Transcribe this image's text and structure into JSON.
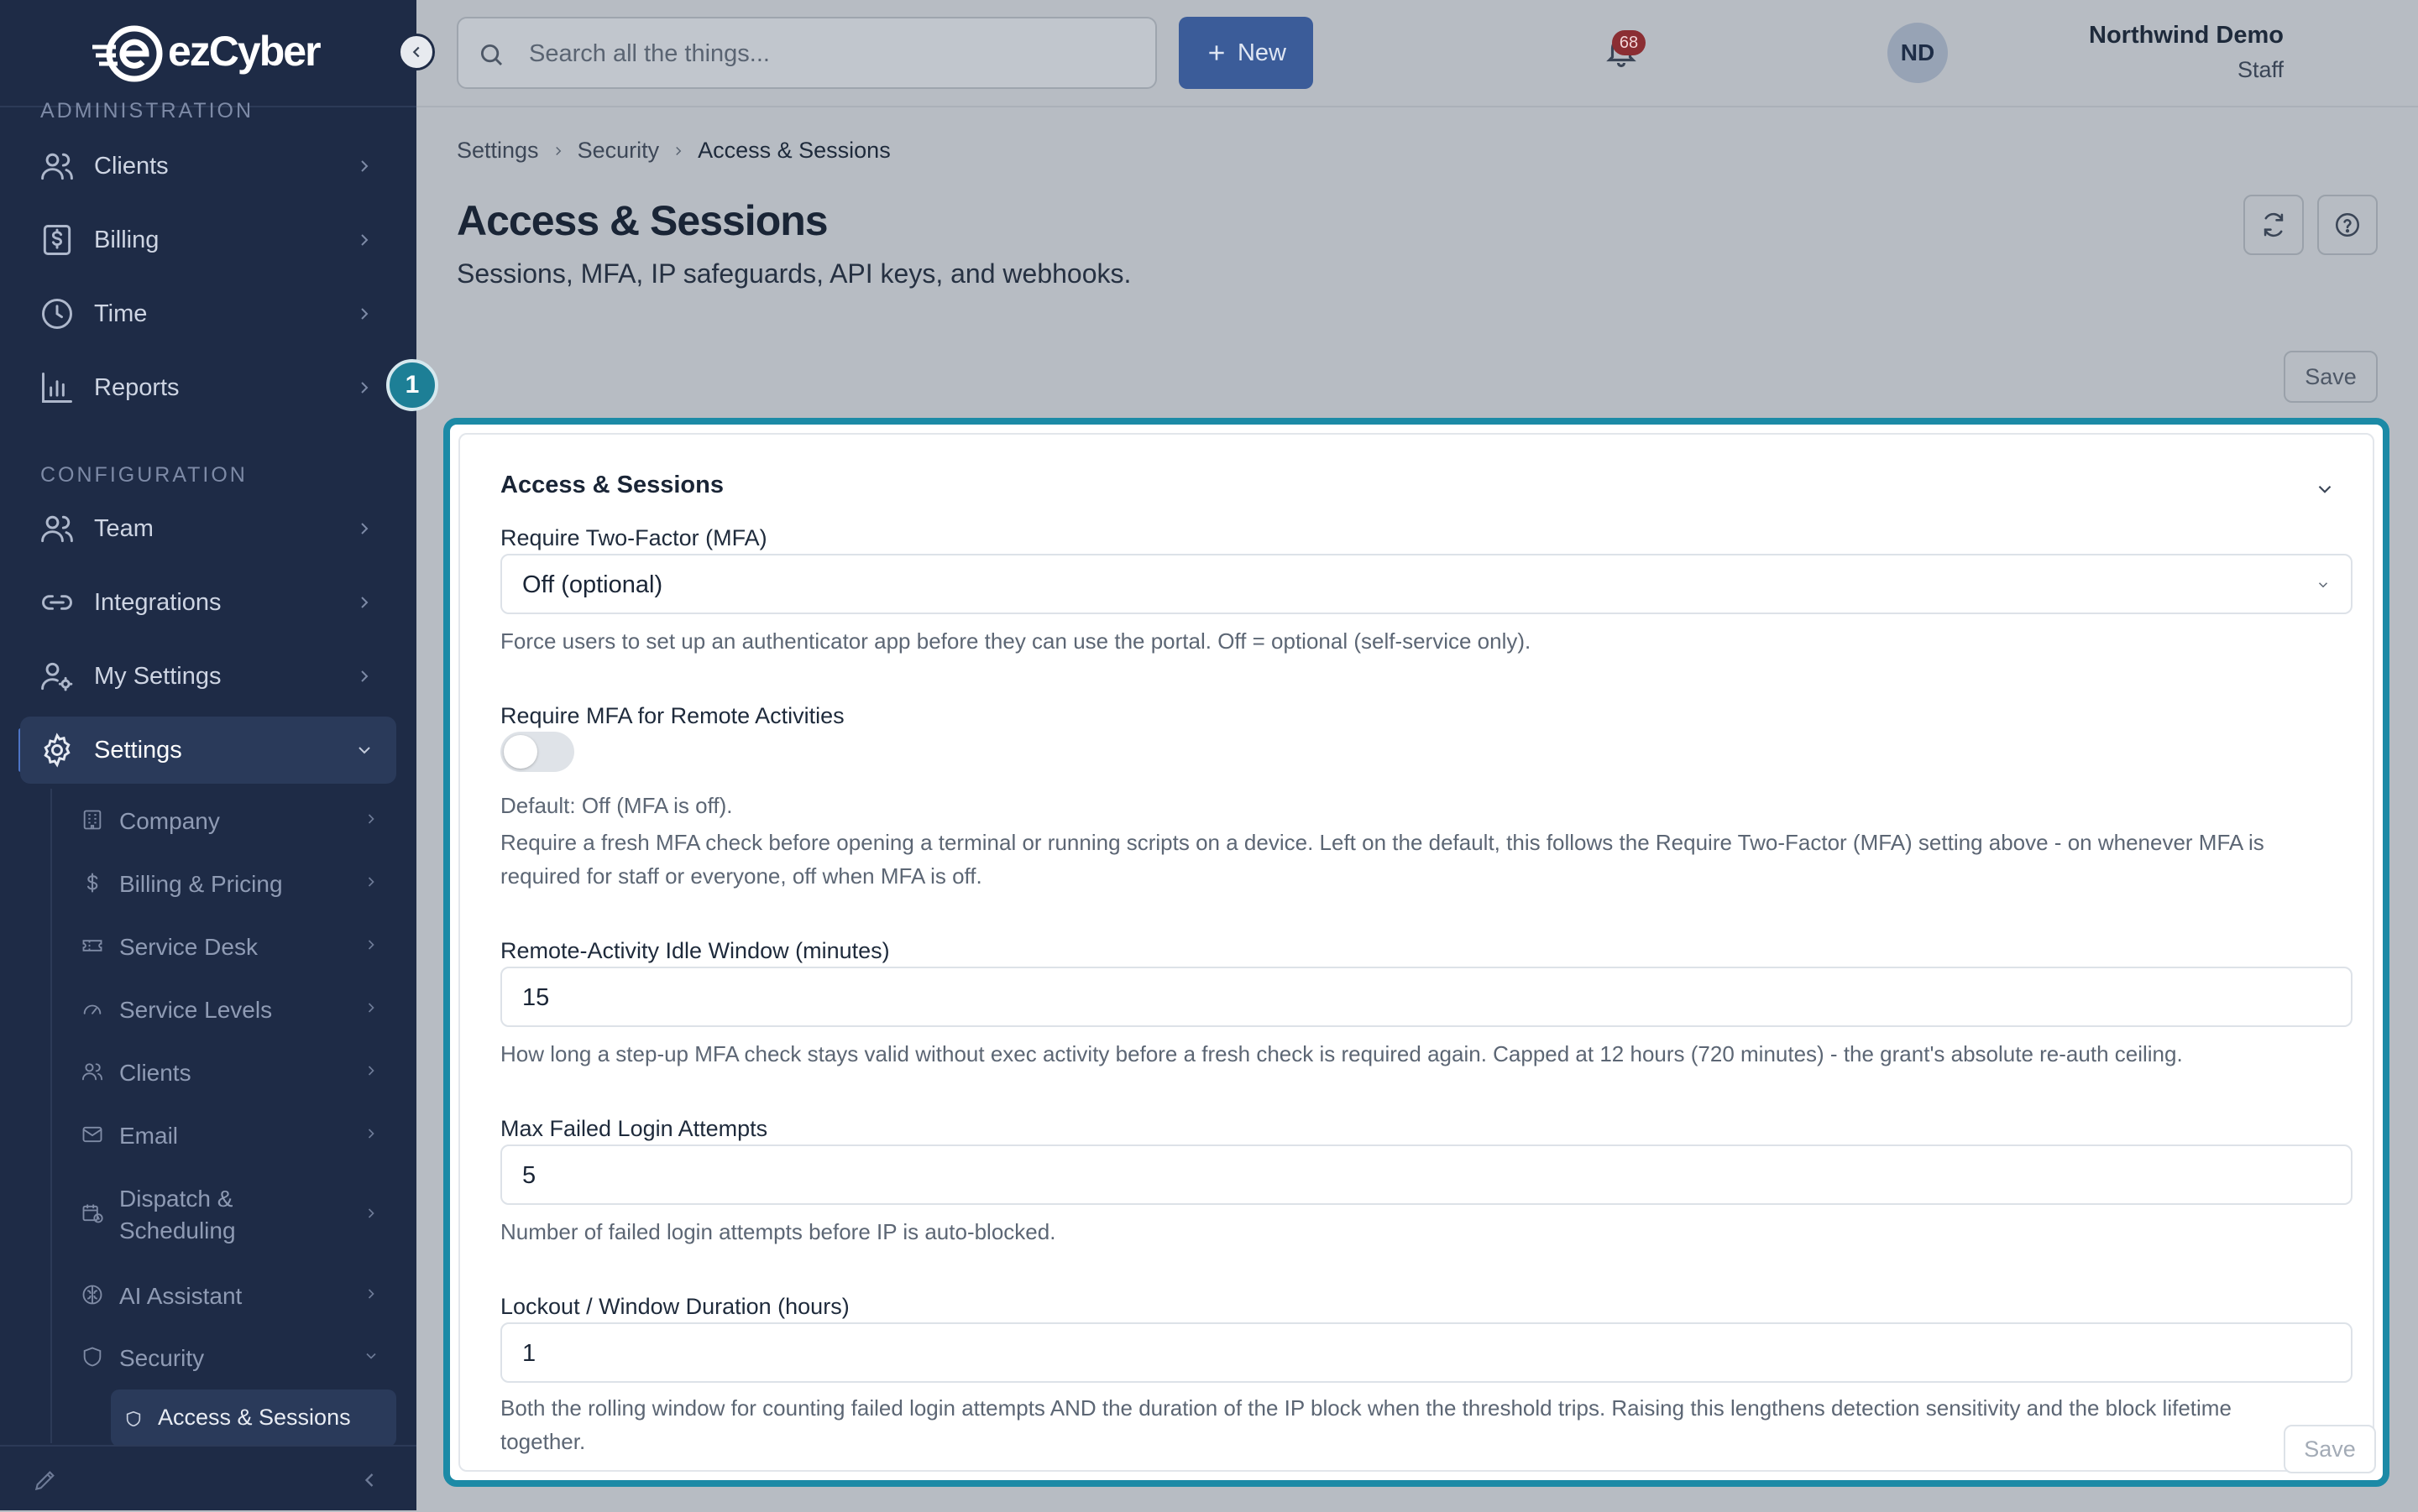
{
  "brand": {
    "logo_text": "ezCyber"
  },
  "sidebar": {
    "administration_label": "ADMINISTRATION",
    "configuration_label": "CONFIGURATION",
    "admin_items": [
      {
        "label": "Clients",
        "icon": "users-icon"
      },
      {
        "label": "Billing",
        "icon": "dollar-receipt-icon"
      },
      {
        "label": "Time",
        "icon": "clock-icon"
      },
      {
        "label": "Reports",
        "icon": "bar-chart-icon"
      }
    ],
    "config_items": [
      {
        "label": "Team",
        "icon": "users-icon"
      },
      {
        "label": "Integrations",
        "icon": "link-icon"
      },
      {
        "label": "My Settings",
        "icon": "user-gear-icon"
      },
      {
        "label": "Settings",
        "icon": "gear-icon",
        "active": true
      }
    ],
    "settings_sub_items": [
      {
        "label": "Company",
        "icon": "building-icon"
      },
      {
        "label": "Billing & Pricing",
        "icon": "dollar-icon"
      },
      {
        "label": "Service Desk",
        "icon": "ticket-icon"
      },
      {
        "label": "Service Levels",
        "icon": "gauge-icon"
      },
      {
        "label": "Clients",
        "icon": "users-icon"
      },
      {
        "label": "Email",
        "icon": "mail-icon"
      },
      {
        "label": "Dispatch &\nScheduling",
        "icon": "calendar-clock-icon"
      },
      {
        "label": "AI Assistant",
        "icon": "brain-icon"
      },
      {
        "label": "Security",
        "icon": "shield-icon",
        "expanded": true
      }
    ],
    "security_sub_items": [
      {
        "label": "Access & Sessions",
        "icon": "shield-icon",
        "active": true
      }
    ]
  },
  "header": {
    "search_placeholder": "Search all the things...",
    "new_button": "New",
    "notification_count": "68",
    "user_name": "Northwind Demo",
    "user_role": "Staff",
    "avatar_initials": "ND"
  },
  "breadcrumb": [
    "Settings",
    "Security",
    "Access & Sessions"
  ],
  "page": {
    "title": "Access & Sessions",
    "subtitle": "Sessions, MFA, IP safeguards, API keys, and webhooks.",
    "save_label": "Save",
    "step_number": "1"
  },
  "card": {
    "title": "Access & Sessions",
    "mfa_label": "Require Two-Factor (MFA)",
    "mfa_value": "Off (optional)",
    "mfa_help": "Force users to set up an authenticator app before they can use the portal. Off = optional (self-service only).",
    "remote_label": "Require MFA for Remote Activities",
    "remote_toggle_on": false,
    "remote_default": "Default: Off (MFA is off).",
    "remote_help": "Require a fresh MFA check before opening a terminal or running scripts on a device. Left on the default, this follows the Require Two-Factor (MFA) setting above - on whenever MFA is required for staff or everyone, off when MFA is off.",
    "idle_label": "Remote-Activity Idle Window (minutes)",
    "idle_value": "15",
    "idle_help": "How long a step-up MFA check stays valid without exec activity before a fresh check is required again. Capped at 12 hours (720 minutes) - the grant's absolute re-auth ceiling.",
    "failed_label": "Max Failed Login Attempts",
    "failed_value": "5",
    "failed_help": "Number of failed login attempts before IP is auto-blocked.",
    "lockout_label": "Lockout / Window Duration (hours)",
    "lockout_value": "1",
    "lockout_help": "Both the rolling window for counting failed login attempts AND the duration of the IP block when the threshold trips. Raising this lengthens detection sensitivity and the block lifetime together.",
    "save_label": "Save"
  },
  "colors": {
    "sidebar_bg": "#1e2b46",
    "accent": "#3b5c99",
    "highlight": "#1c8aa6"
  }
}
